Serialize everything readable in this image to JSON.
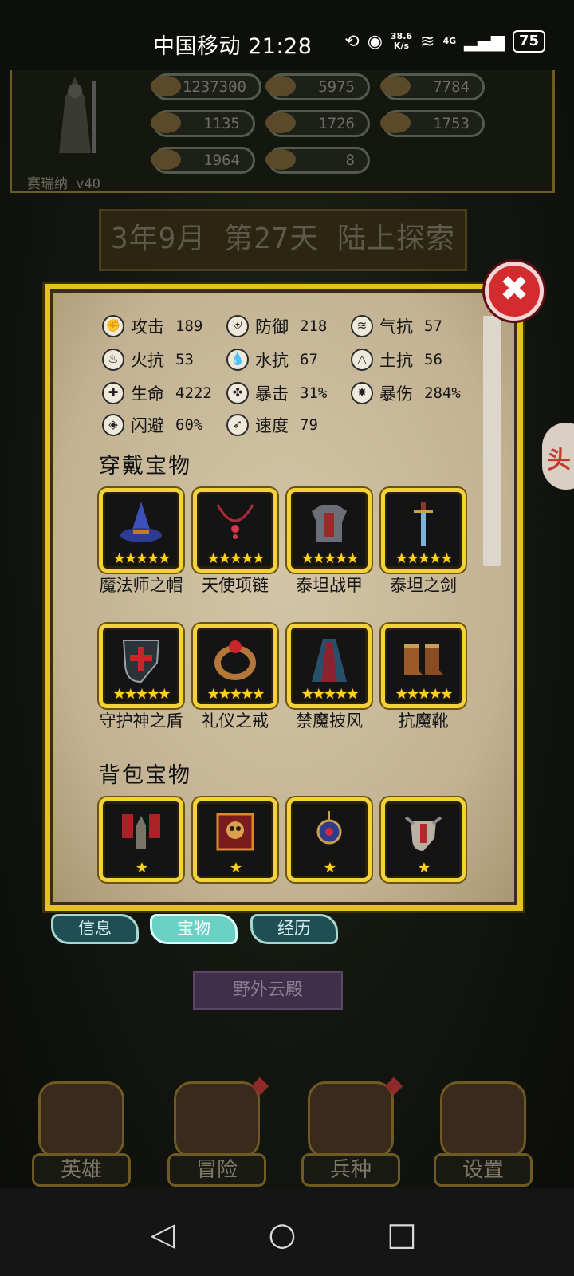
{
  "status_bar": {
    "carrier_time": "中国移动 21:28",
    "net_speed_value": "38.6",
    "net_speed_unit": "K/s",
    "signal_label": "4G",
    "battery": "75"
  },
  "hero": {
    "name": "赛瑞纳 v40",
    "resources": [
      "1237300",
      "5975",
      "7784",
      "1135",
      "1726",
      "1753",
      "1964",
      "8"
    ]
  },
  "date_banner": "3年9月 第27天 陆上探索",
  "side_edge_label": "头",
  "dialog": {
    "close_glyph": "✖",
    "stats": [
      {
        "label": "攻击",
        "value": "189",
        "icon": "fist-icon",
        "glyph": "✊"
      },
      {
        "label": "防御",
        "value": "218",
        "icon": "shield-icon",
        "glyph": "⛨"
      },
      {
        "label": "气抗",
        "value": "57",
        "icon": "wind-icon",
        "glyph": "≋"
      },
      {
        "label": "火抗",
        "value": "53",
        "icon": "fire-icon",
        "glyph": "♨"
      },
      {
        "label": "水抗",
        "value": "67",
        "icon": "water-drop-icon",
        "glyph": "💧"
      },
      {
        "label": "土抗",
        "value": "56",
        "icon": "earth-icon",
        "glyph": "△"
      },
      {
        "label": "生命",
        "value": "4222",
        "icon": "heart-plus-icon",
        "glyph": "✚"
      },
      {
        "label": "暴击",
        "value": "31%",
        "icon": "clover-icon",
        "glyph": "✤"
      },
      {
        "label": "暴伤",
        "value": "284%",
        "icon": "splash-icon",
        "glyph": "✸"
      },
      {
        "label": "闪避",
        "value": "60%",
        "icon": "dodge-icon",
        "glyph": "◈"
      },
      {
        "label": "速度",
        "value": "79",
        "icon": "boot-speed-icon",
        "glyph": "➶"
      }
    ],
    "equipped_title": "穿戴宝物",
    "equipped": [
      {
        "name": "魔法师之帽",
        "stars": "★★★★★",
        "icon": "wizard-hat-icon"
      },
      {
        "name": "天使项链",
        "stars": "★★★★★",
        "icon": "necklace-icon"
      },
      {
        "name": "泰坦战甲",
        "stars": "★★★★★",
        "icon": "armor-icon"
      },
      {
        "name": "泰坦之剑",
        "stars": "★★★★★",
        "icon": "sword-icon"
      },
      {
        "name": "守护神之盾",
        "stars": "★★★★★",
        "icon": "cross-shield-icon"
      },
      {
        "name": "礼仪之戒",
        "stars": "★★★★★",
        "icon": "ring-icon"
      },
      {
        "name": "禁魔披风",
        "stars": "★★★★★",
        "icon": "cloak-icon"
      },
      {
        "name": "抗魔靴",
        "stars": "★★★★★",
        "icon": "boots-icon"
      }
    ],
    "backpack_title": "背包宝物",
    "backpack": [
      {
        "stars": "★",
        "icon": "banner-knight-icon"
      },
      {
        "stars": "★",
        "icon": "skull-banner-icon"
      },
      {
        "stars": "★",
        "icon": "amulet-icon"
      },
      {
        "stars": "★",
        "icon": "crest-shield-icon"
      }
    ]
  },
  "tabs": [
    "信息",
    "宝物",
    "经历"
  ],
  "location": "野外云殿",
  "bottom_nav": [
    "英雄",
    "冒险",
    "兵种",
    "设置"
  ],
  "system_nav": {
    "back": "◁",
    "home": "○",
    "recent": "□"
  }
}
